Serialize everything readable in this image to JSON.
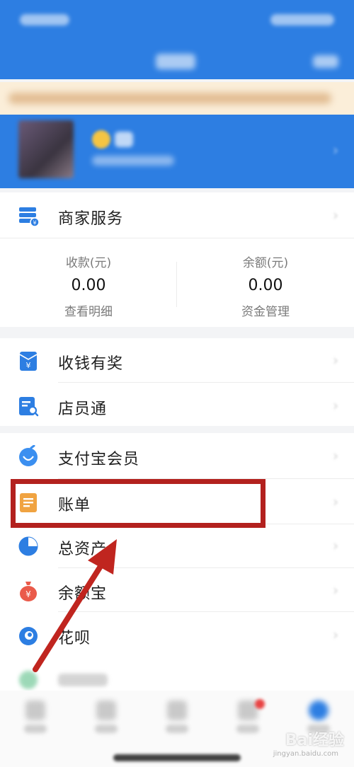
{
  "menu": {
    "merchant_service": "商家服务",
    "cash_reward": "收钱有奖",
    "clerk": "店员通",
    "member": "支付宝会员",
    "bill": "账单",
    "total_assets": "总资产",
    "yuebao": "余额宝",
    "huabei": "花呗"
  },
  "stats": {
    "left": {
      "caption": "收款(元)",
      "value": "0.00",
      "link": "查看明细"
    },
    "right": {
      "caption": "余额(元)",
      "value": "0.00",
      "link": "资金管理"
    }
  },
  "watermark": {
    "text": "Bai经验",
    "url": "jingyan.baidu.com"
  },
  "colors": {
    "brand_blue": "#2d7ee2",
    "highlight_red": "#b3211e",
    "bill_orange": "#f0a341",
    "yuebao_red": "#ea5a4a"
  },
  "icons": {
    "merchant_service": "merchant-store-icon",
    "cash_reward": "red-envelope-yuan-icon",
    "clerk": "clerk-search-icon",
    "member": "member-badge-icon",
    "bill": "bill-document-icon",
    "total_assets": "pie-chart-icon",
    "yuebao": "money-bag-icon",
    "huabei": "huabei-icon"
  }
}
